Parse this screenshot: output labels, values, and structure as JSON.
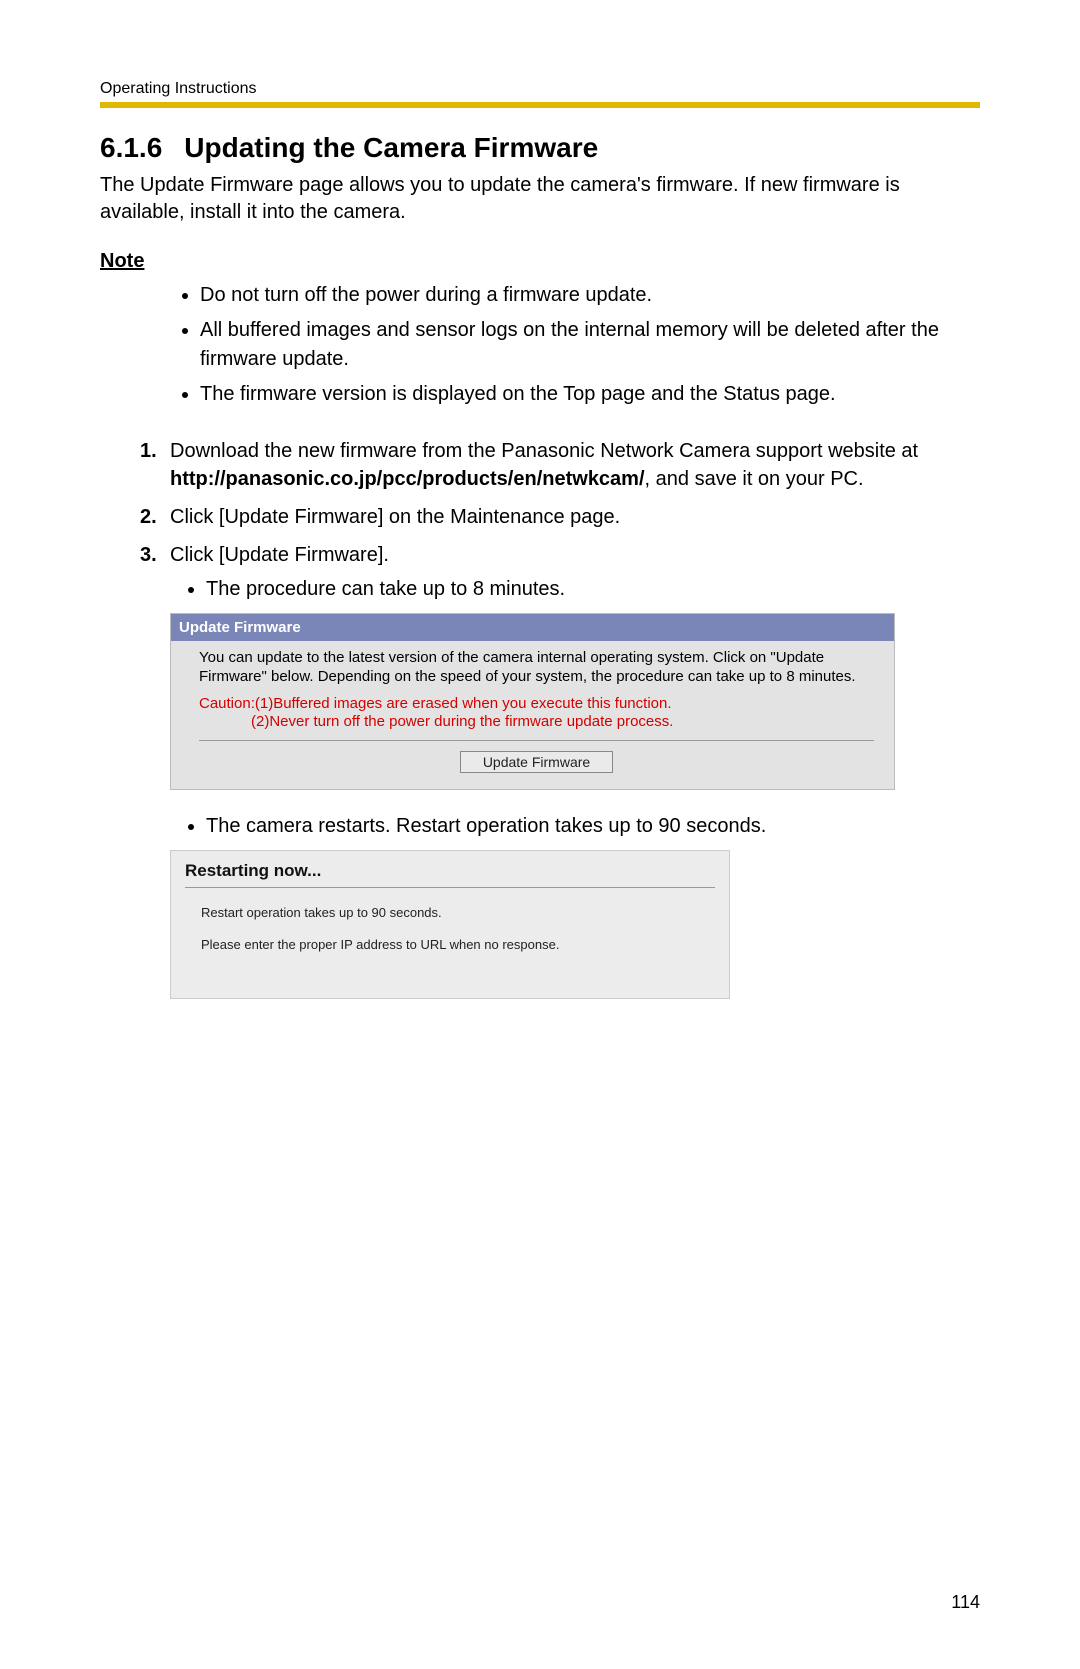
{
  "header": {
    "label": "Operating Instructions"
  },
  "section": {
    "number": "6.1.6",
    "title": "Updating the Camera Firmware",
    "intro": "The Update Firmware page allows you to update the camera's firmware. If new firmware is available, install it into the camera."
  },
  "note": {
    "heading": "Note",
    "items": [
      "Do not turn off the power during a firmware update.",
      "All buffered images and sensor logs on the internal memory will be deleted after the firmware update.",
      "The firmware version is displayed on the Top page and the Status page."
    ]
  },
  "steps": {
    "step1_pre": "Download the new firmware from the Panasonic Network Camera support website at ",
    "step1_url": "http://panasonic.co.jp/pcc/products/en/netwkcam/",
    "step1_post": ", and save it on your PC.",
    "step2": "Click [Update Firmware] on the Maintenance page.",
    "step3": "Click [Update Firmware].",
    "step3_sub1": "The procedure can take up to 8 minutes.",
    "step3_sub2": "The camera restarts. Restart operation takes up to 90 seconds."
  },
  "panel": {
    "title": "Update Firmware",
    "desc": "You can update to the latest version of the camera internal operating system. Click on \"Update Firmware\" below. Depending on the speed of your system, the procedure can take up to 8 minutes.",
    "caution_line1": "Caution:(1)Buffered images are erased when you execute this function.",
    "caution_line2": "(2)Never turn off the power during the firmware update process.",
    "button": "Update Firmware"
  },
  "restart_panel": {
    "title": "Restarting now...",
    "line1": "Restart operation takes up to 90 seconds.",
    "line2": "Please enter the proper IP address to URL when no response."
  },
  "page_number": "114"
}
